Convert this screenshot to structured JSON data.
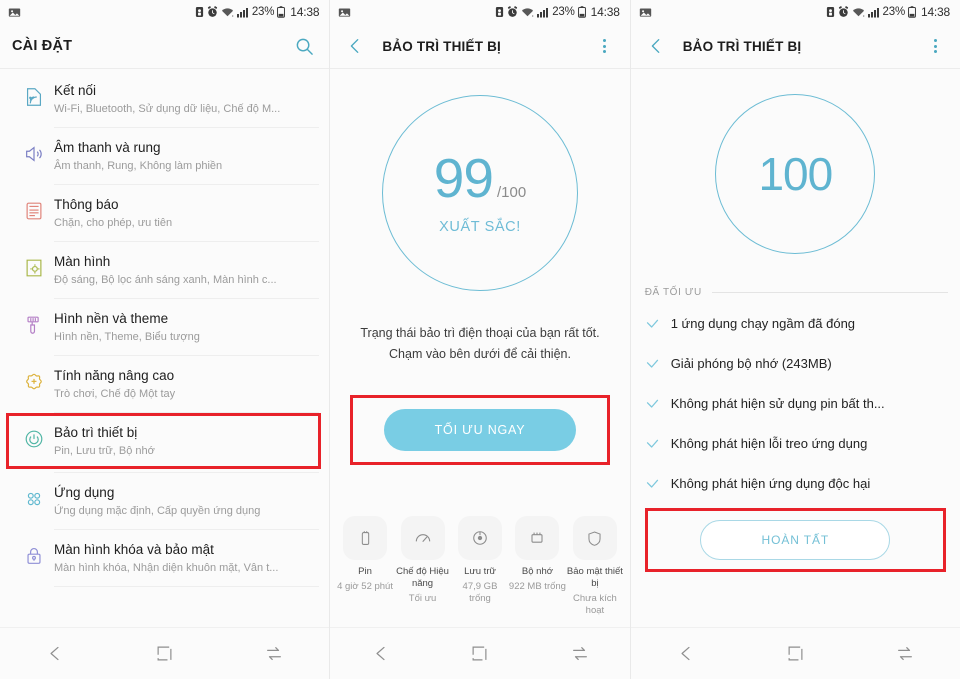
{
  "status_bar": {
    "battery_percent": "23%",
    "time": "14:38",
    "icons": [
      "image-icon",
      "sim-icon",
      "alarm-icon",
      "wifi-icon",
      "signal-icon",
      "battery-icon"
    ]
  },
  "panel1": {
    "title": "CÀI ĐẶT",
    "search_icon": "search-icon",
    "items": [
      {
        "title": "Kết nối",
        "subtitle": "Wi-Fi, Bluetooth, Sử dụng dữ liệu, Chế độ M...",
        "icon": "connections-icon",
        "color": "#5aa8c4",
        "highlighted": false
      },
      {
        "title": "Âm thanh và rung",
        "subtitle": "Âm thanh, Rung, Không làm phiền",
        "icon": "sound-icon",
        "color": "#7b7fc4",
        "highlighted": false
      },
      {
        "title": "Thông báo",
        "subtitle": "Chặn, cho phép, ưu tiên",
        "icon": "notifications-icon",
        "color": "#e0847a",
        "highlighted": false
      },
      {
        "title": "Màn hình",
        "subtitle": "Độ sáng, Bộ lọc ánh sáng xanh, Màn hình c...",
        "icon": "display-icon",
        "color": "#a9b84a",
        "highlighted": false
      },
      {
        "title": "Hình nền và theme",
        "subtitle": "Hình nền, Theme, Biểu tượng",
        "icon": "wallpaper-icon",
        "color": "#b47fc6",
        "highlighted": false
      },
      {
        "title": "Tính năng nâng cao",
        "subtitle": "Trò chơi, Chế độ Một tay",
        "icon": "advanced-features-icon",
        "color": "#dcb23c",
        "highlighted": false
      },
      {
        "title": "Bảo trì thiết bị",
        "subtitle": "Pin, Lưu trữ, Bộ nhớ",
        "icon": "device-maintenance-icon",
        "color": "#4fb5a4",
        "highlighted": true
      },
      {
        "title": "Ứng dụng",
        "subtitle": "Ứng dụng mặc định, Cấp quyền ứng dụng",
        "icon": "apps-icon",
        "color": "#5fb8cf",
        "highlighted": false
      },
      {
        "title": "Màn hình khóa và bảo mật",
        "subtitle": "Màn hình khóa, Nhận diện khuôn mặt, Vân t...",
        "icon": "lock-security-icon",
        "color": "#8f8fd6",
        "highlighted": false
      }
    ]
  },
  "panel2": {
    "title": "BẢO TRÌ THIẾT BỊ",
    "back_icon": "back-arrow-icon",
    "menu_icon": "more-options-icon",
    "score": "99",
    "score_denominator": "/100",
    "score_label": "XUẤT SẮC!",
    "description_line1": "Trạng thái bảo trì điện thoại của bạn rất tốt.",
    "description_line2": "Chạm vào bên dưới để cải thiện.",
    "optimize_button": "TỐI ƯU NGAY",
    "tiles": [
      {
        "name": "Pin",
        "value": "4 giờ 52 phút",
        "icon": "battery-tile-icon"
      },
      {
        "name": "Chế độ Hiệu năng",
        "value": "Tối ưu",
        "icon": "performance-tile-icon"
      },
      {
        "name": "Lưu trữ",
        "value": "47,9 GB trống",
        "icon": "storage-tile-icon"
      },
      {
        "name": "Bộ nhớ",
        "value": "922 MB trống",
        "icon": "memory-tile-icon"
      },
      {
        "name": "Bảo mật thiết bị",
        "value": "Chưa kích hoạt",
        "icon": "security-tile-icon"
      }
    ]
  },
  "panel3": {
    "title": "BẢO TRÌ THIẾT BỊ",
    "back_icon": "back-arrow-icon",
    "menu_icon": "more-options-icon",
    "score": "100",
    "section_label": "ĐÃ TỐI ƯU",
    "items": [
      "1 ứng dụng chạy ngầm đã đóng",
      "Giải phóng bộ nhớ (243MB)",
      "Không phát hiện sử dụng pin bất th...",
      "Không phát hiện lỗi treo ứng dụng",
      "Không phát hiện ứng dụng độc hại"
    ],
    "done_button": "HOÀN TẤT"
  },
  "navbar": {
    "back": "back-nav-icon",
    "home": "home-nav-icon",
    "recents": "recents-nav-icon"
  },
  "colors": {
    "accent": "#6cbcd4",
    "primary_button": "#79cde4",
    "highlight_box": "#e8222a",
    "text": "#202020",
    "subtext": "#9b9b9b"
  }
}
